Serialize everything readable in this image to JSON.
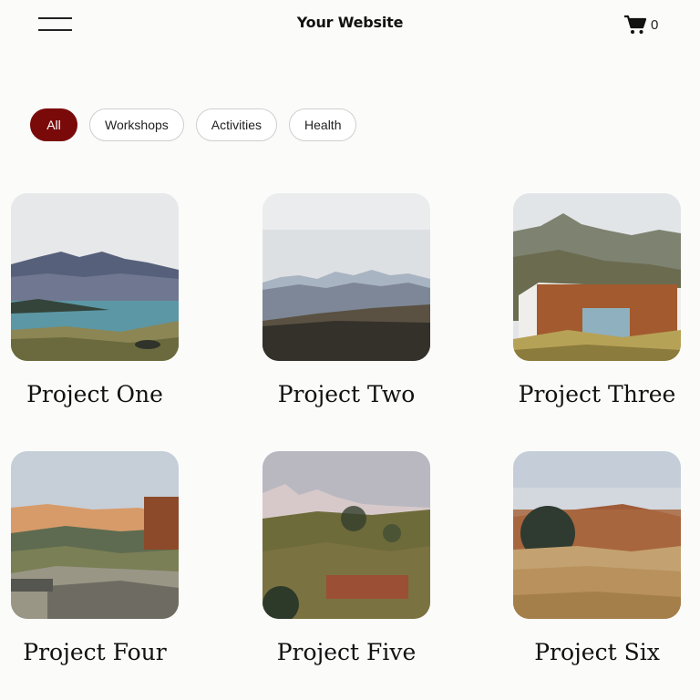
{
  "header": {
    "menu_icon": "hamburger-menu-icon",
    "site_title": "Your Website",
    "cart_icon": "shopping-cart-icon",
    "cart_count": "0"
  },
  "filters": {
    "items": [
      {
        "label": "All",
        "active": true
      },
      {
        "label": "Workshops",
        "active": false
      },
      {
        "label": "Activities",
        "active": false
      },
      {
        "label": "Health",
        "active": false
      }
    ],
    "active_color": "#7a0a0a"
  },
  "projects": [
    {
      "title": "Project One"
    },
    {
      "title": "Project Two"
    },
    {
      "title": "Project Three"
    },
    {
      "title": "Project Four"
    },
    {
      "title": "Project Five"
    },
    {
      "title": "Project Six"
    }
  ]
}
